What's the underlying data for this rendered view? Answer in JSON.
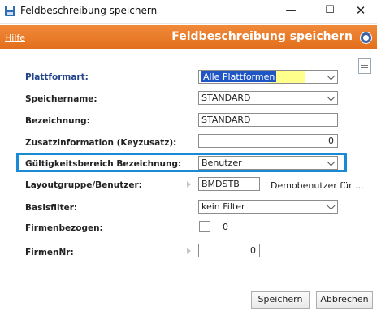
{
  "window": {
    "title": "Feldbeschreibung speichern"
  },
  "header": {
    "help_label": "Hilfe",
    "title": "Feldbeschreibung speichern"
  },
  "form": {
    "plattformart": {
      "label": "Plattformart:",
      "value": "Alle Plattformen"
    },
    "speichername": {
      "label": "Speichername:",
      "value": "STANDARD"
    },
    "bezeichnung": {
      "label": "Bezeichnung:",
      "value": "STANDARD"
    },
    "zusatzinformation": {
      "label": "Zusatzinformation (Keyzusatz):",
      "value": "0"
    },
    "gueltigkeitsbereich": {
      "label": "Gültigkeitsbereich Bezeichnung:",
      "value": "Benutzer"
    },
    "layoutgruppe": {
      "label": "Layoutgruppe/Benutzer:",
      "value": "BMDSTB",
      "description": "Demobenutzer für ..."
    },
    "basisfilter": {
      "label": "Basisfilter:",
      "value": "kein Filter"
    },
    "firmenbezogen": {
      "label": "Firmenbezogen:",
      "value": "0",
      "checked": false
    },
    "firmennr": {
      "label": "FirmenNr:",
      "value": "0"
    }
  },
  "buttons": {
    "save": "Speichern",
    "cancel": "Abbrechen"
  },
  "colors": {
    "accent": "#e26f1d",
    "highlight_border": "#1a8ad4",
    "label_blue": "#23458b"
  }
}
